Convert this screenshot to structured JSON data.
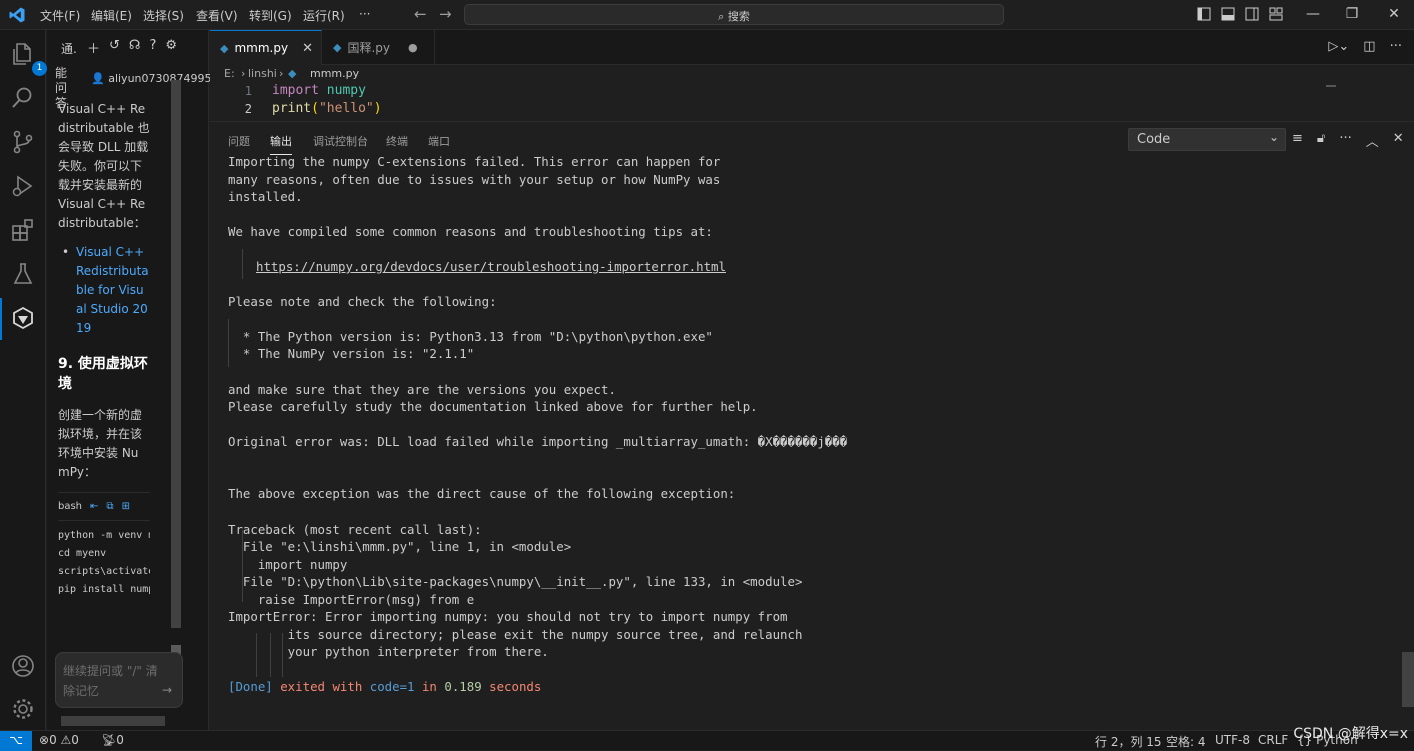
{
  "titlebar": {
    "menus": [
      "文件(F)",
      "编辑(E)",
      "选择(S)",
      "查看(V)",
      "转到(G)",
      "运行(R)",
      "···"
    ],
    "search_placeholder": "搜索",
    "accent_color": "#0078d4"
  },
  "activitybar": {
    "items": [
      "explorer-icon",
      "search-icon",
      "source-control-icon",
      "run-debug-icon",
      "extensions-icon",
      "testing-icon",
      "ai-assistant-icon"
    ],
    "explorer_badge": "1",
    "bottom": [
      "account-icon",
      "manage-gear-icon"
    ]
  },
  "sidebar": {
    "header": "通.",
    "side_label": "能问答",
    "user": "aliyun0730874995",
    "messages": [
      "Visual C++ Redistributable 也会导致 DLL 加载失败。你可以下载并安装最新的 Visual C++ Redistributable："
    ],
    "link": "Visual C++ Redistributable for Visual Studio 2019",
    "section_heading": "9. 使用虚拟环境",
    "section_text": "创建一个新的虚拟环境，并在该环境中安装 NumPy：",
    "code_lang": "bash",
    "code_lines": [
      "python -m venv myenv",
      "cd myenv",
      "scripts\\activate",
      "pip install numpy"
    ],
    "input_placeholder": "继续提问或 \"/\" 清除记忆",
    "send_icon": "→"
  },
  "tabs": [
    {
      "label": "mmm.py",
      "active": true
    },
    {
      "label": "国释.py",
      "active": false,
      "modified": true
    }
  ],
  "breadcrumb": [
    "E:",
    "linshi",
    "mmm.py"
  ],
  "editor": {
    "lines": [
      {
        "num": "1",
        "kw": "import",
        "rest": " numpy"
      },
      {
        "num": "2",
        "fn": "print",
        "open": "(",
        "str": "\"hello\"",
        "close": ")"
      }
    ]
  },
  "panel": {
    "tabs": [
      "问题",
      "输出",
      "调试控制台",
      "终端",
      "端口"
    ],
    "active_tab": "输出",
    "output_channel": "Code",
    "output_lines": [
      "Importing the numpy C-extensions failed. This error can happen for",
      "many reasons, often due to issues with your setup or how NumPy was",
      "installed.",
      "We have compiled some common reasons and troubleshooting tips at:",
      "https://numpy.org/devdocs/user/troubleshooting-importerror.html",
      "Please note and check the following:",
      "  * The Python version is: Python3.13 from \"D:\\python\\python.exe\"",
      "  * The NumPy version is: \"2.1.1\"",
      "and make sure that they are the versions you expect.",
      "Please carefully study the documentation linked above for further help.",
      "Original error was: DLL load failed while importing _multiarray_umath: �X������j���",
      "The above exception was the direct cause of the following exception:",
      "Traceback (most recent call last):",
      "  File \"e:\\linshi\\mmm.py\", line 1, in <module>",
      "    import numpy",
      "  File \"D:\\python\\Lib\\site-packages\\numpy\\__init__.py\", line 133, in <module>",
      "    raise ImportError(msg) from e",
      "ImportError: Error importing numpy: you should not try to import numpy from",
      "        its source directory; please exit the numpy source tree, and relaunch",
      "        your python interpreter from there."
    ],
    "done": {
      "tag": "[Done]",
      "exited": " exited with ",
      "code_label": "code=1",
      "in": " in ",
      "time": "0.189",
      "unit": " seconds"
    }
  },
  "statusbar": {
    "errors": "0",
    "warnings": "0",
    "ports": "0",
    "position": "行 2，列 15",
    "spaces": "空格: 4",
    "encoding": "UTF-8",
    "eol": "CRLF",
    "language": "{} Python",
    "watermark": "CSDN @解得x=x"
  }
}
